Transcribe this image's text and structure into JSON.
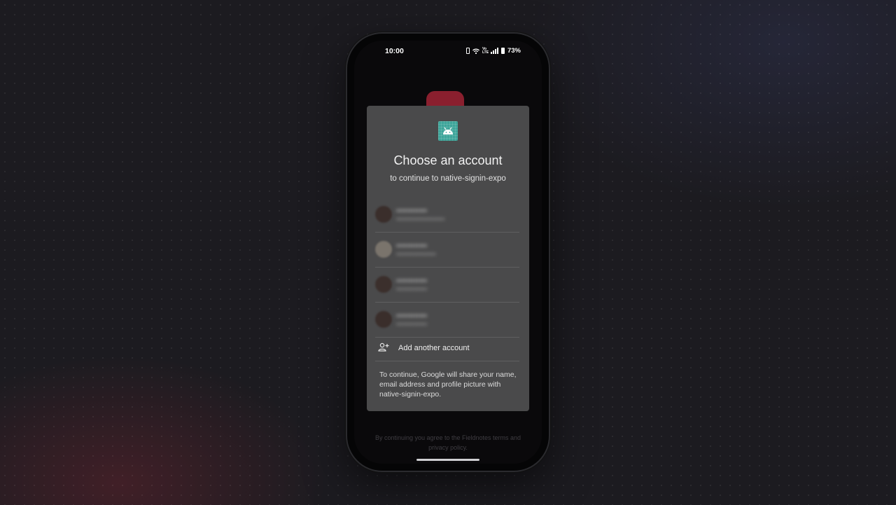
{
  "status_bar": {
    "time": "10:00",
    "volte": "Vo LTE",
    "battery": "73%"
  },
  "dialog": {
    "title": "Choose an account",
    "subtitle": "to continue to native-signin-expo",
    "accounts": [
      {
        "name": "••••••••••••",
        "email": "••••••••••••••••••••••",
        "avatar_color": "#3a2e2b"
      },
      {
        "name": "••••••••••••",
        "email": "••••••••••••••••••",
        "avatar_color": "#7a746c"
      },
      {
        "name": "••••••••••••",
        "email": "••••••••••••••",
        "avatar_color": "#3b2f2c"
      },
      {
        "name": "••••••••••••",
        "email": "••••••••••••••",
        "avatar_color": "#3a2e2b"
      }
    ],
    "add_account_label": "Add another account",
    "disclaimer": "To continue, Google will share your name, email address and profile picture with native-signin-expo."
  },
  "app_footer": "By continuing you agree to the Fieldnotes terms and privacy policy.",
  "colors": {
    "dialog_bg": "#4a4a4b",
    "app_icon": "#3ea59a",
    "app_logo": "#8a1f2e"
  }
}
